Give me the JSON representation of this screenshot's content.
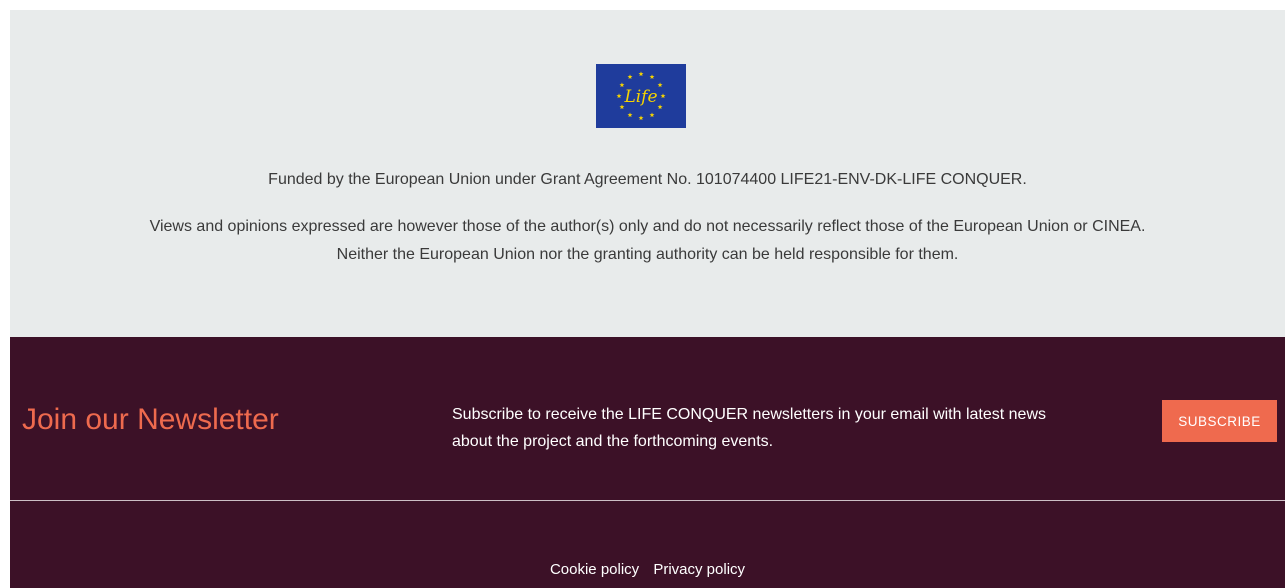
{
  "funding": {
    "logo_icon": "eu-life-logo",
    "logo_text": "Life",
    "funded_text": "Funded by the European Union under Grant Agreement No. 101074400 LIFE21-ENV-DK-LIFE CONQUER.",
    "disclaimer_text": "Views and opinions expressed are however those of the author(s) only and do not necessarily reflect those of the European Union or CINEA. Neither the European Union nor the granting authority can be held responsible for them."
  },
  "newsletter": {
    "heading": "Join our Newsletter",
    "description": "Subscribe to receive the LIFE CONQUER newsletters in your email with latest news about the project and the forthcoming events.",
    "subscribe_label": "SUBSCRIBE"
  },
  "footer": {
    "links": [
      {
        "label": "Cookie policy"
      },
      {
        "label": "Privacy policy"
      }
    ]
  },
  "colors": {
    "funding_bg": "#e8ebeb",
    "footer_bg": "#3c1127",
    "accent": "#ee6a4e",
    "eu_blue": "#1f3c9c",
    "eu_yellow": "#f5d300"
  }
}
